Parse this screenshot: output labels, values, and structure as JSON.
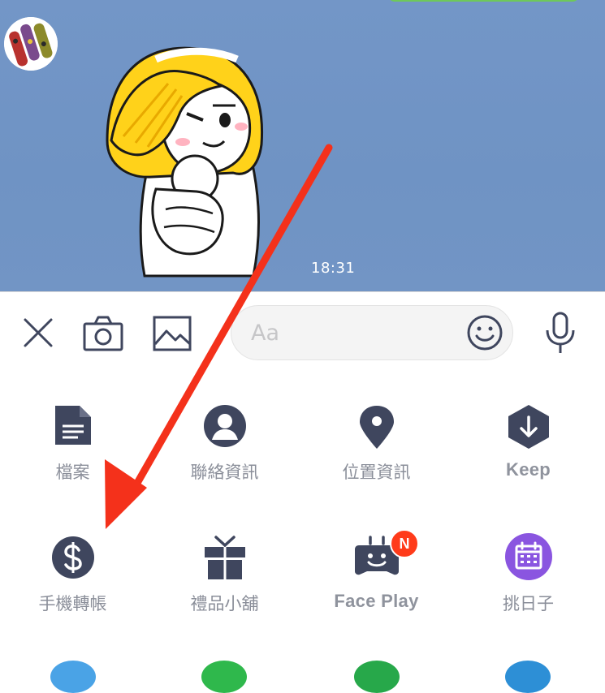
{
  "chat": {
    "timestamp": "18:31"
  },
  "composer": {
    "placeholder": "Aa",
    "icons": [
      "close-icon",
      "camera-icon",
      "image-icon",
      "emoji-icon",
      "microphone-icon"
    ]
  },
  "menu": {
    "items": [
      {
        "label": "檔案",
        "icon": "document-icon"
      },
      {
        "label": "聯絡資訊",
        "icon": "contact-icon"
      },
      {
        "label": "位置資訊",
        "icon": "location-pin-icon"
      },
      {
        "label": "Keep",
        "icon": "keep-hexagon-icon"
      },
      {
        "label": "手機轉帳",
        "icon": "dollar-icon"
      },
      {
        "label": "禮品小舖",
        "icon": "gift-icon"
      },
      {
        "label": "Face Play",
        "icon": "faceplay-robot-icon",
        "badge": "N"
      },
      {
        "label": "挑日子",
        "icon": "calendar-icon"
      }
    ]
  },
  "colors": {
    "chat_background": "#7195c6",
    "icon_navy": "#3f465e",
    "label_gray": "#8a8e99",
    "badge_red": "#ff3b1a",
    "calendar_purple": "#8a55e0",
    "annotation_arrow": "#f4311b"
  }
}
